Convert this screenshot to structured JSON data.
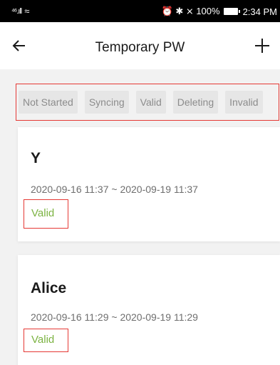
{
  "status_bar": {
    "signal": "⁴⁶.ıll",
    "wifi": "≈",
    "right_text": "⏰ ✱ ⨯ 100%",
    "time": "2:34 PM"
  },
  "header": {
    "title": "Temporary PW",
    "back_icon": "arrow-left-icon",
    "add_icon": "plus-icon"
  },
  "filters": [
    {
      "label": "Not Started"
    },
    {
      "label": "Syncing"
    },
    {
      "label": "Valid"
    },
    {
      "label": "Deleting"
    },
    {
      "label": "Invalid"
    }
  ],
  "passwords": [
    {
      "name": "Y",
      "range": "2020-09-16 11:37 ~ 2020-09-19 11:37",
      "status": "Valid"
    },
    {
      "name": "Alice",
      "range": "2020-09-16 11:29 ~ 2020-09-19 11:29",
      "status": "Valid"
    }
  ],
  "colors": {
    "valid_green": "#7cb342",
    "highlight_red": "#e53935",
    "status_bar_bg": "#000000",
    "chip_bg": "#e6e6e6"
  }
}
